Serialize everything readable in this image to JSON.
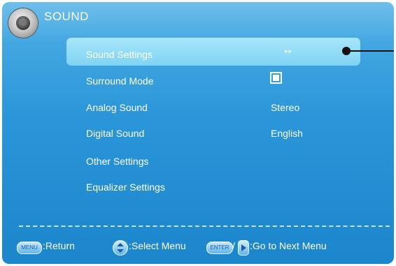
{
  "header": {
    "title": "SOUND",
    "icon": "speaker-icon"
  },
  "menu": {
    "items": [
      {
        "label": "Sound Settings",
        "value": ""
      },
      {
        "label": "Surround Mode",
        "value": ""
      },
      {
        "label": "Analog Sound",
        "value": "Stereo"
      },
      {
        "label": "Digital Sound",
        "value": "English"
      },
      {
        "label": "Other Settings",
        "value": ""
      },
      {
        "label": "Equalizer Settings",
        "value": ""
      }
    ],
    "selected_index": 0,
    "submenu_arrows": "▸▸",
    "surround_mode_checked": true
  },
  "footer": {
    "menu_key": "MENU",
    "return_label": ":Return",
    "select_label": ":Select Menu",
    "enter_key": "ENTER",
    "separator": "/",
    "next_label": ":Go to Next Menu"
  },
  "colors": {
    "background": "#2a95d8",
    "highlight": "#8fdaf6",
    "text": "#ffffff"
  }
}
